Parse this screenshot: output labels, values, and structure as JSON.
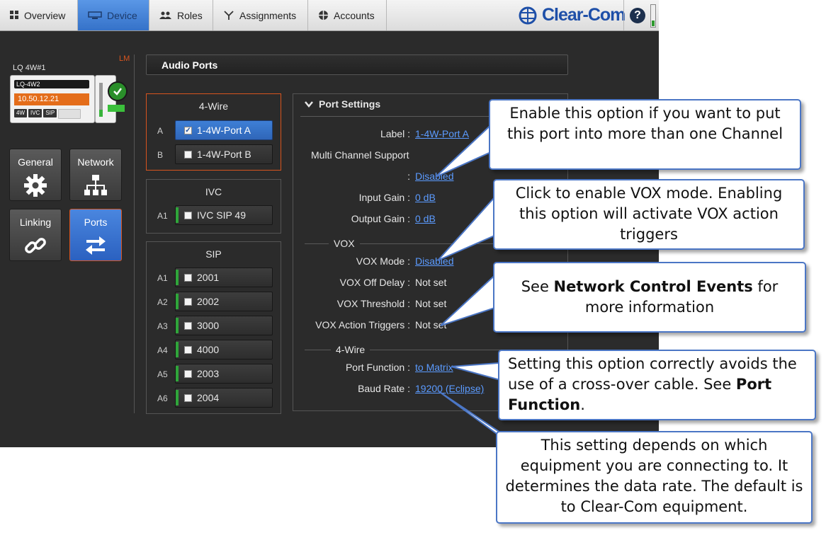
{
  "nav": {
    "tabs": [
      {
        "label": "Overview",
        "icon": "grid-icon"
      },
      {
        "label": "Device",
        "icon": "monitor-icon"
      },
      {
        "label": "Roles",
        "icon": "people-icon"
      },
      {
        "label": "Assignments",
        "icon": "branch-icon"
      },
      {
        "label": "Accounts",
        "icon": "globe-icon"
      }
    ],
    "active_tab": "Device",
    "brand": "Clear-Com",
    "help": "?"
  },
  "device": {
    "badge": "LM",
    "name": "LQ 4W#1",
    "card_name": "LQ-4W2",
    "ip": "10.50.12.21",
    "chips": [
      "4W",
      "IVC",
      "SIP"
    ]
  },
  "side_nav": {
    "general": "General",
    "network": "Network",
    "linking": "Linking",
    "ports": "Ports"
  },
  "audio_ports": {
    "title": "Audio Ports"
  },
  "groups": {
    "fourwire": {
      "title": "4-Wire",
      "ports": [
        {
          "slot": "A",
          "name": "1-4W-Port A",
          "checked": true
        },
        {
          "slot": "B",
          "name": "1-4W-Port B",
          "checked": false
        }
      ]
    },
    "ivc": {
      "title": "IVC",
      "ports": [
        {
          "slot": "A1",
          "name": "IVC SIP 49",
          "checked": false
        }
      ]
    },
    "sip": {
      "title": "SIP",
      "ports": [
        {
          "slot": "A1",
          "name": "2001"
        },
        {
          "slot": "A2",
          "name": "2002"
        },
        {
          "slot": "A3",
          "name": "3000"
        },
        {
          "slot": "A4",
          "name": "4000"
        },
        {
          "slot": "A5",
          "name": "2003"
        },
        {
          "slot": "A6",
          "name": "2004"
        }
      ]
    }
  },
  "port_settings": {
    "title": "Port Settings",
    "label_key": "Label :",
    "label_val": "1-4W-Port A",
    "multi_key": "Multi Channel Support",
    "multi_colon": ":",
    "multi_val": "Disabled",
    "input_gain_key": "Input Gain :",
    "input_gain_val": "0 dB",
    "output_gain_key": "Output Gain :",
    "output_gain_val": "0 dB",
    "vox_section": "VOX",
    "vox_mode_key": "VOX Mode :",
    "vox_mode_val": "Disabled",
    "vox_off_key": "VOX Off Delay :",
    "vox_off_val": "Not set",
    "vox_thr_key": "VOX Threshold :",
    "vox_thr_val": "Not set",
    "vox_act_key": "VOX Action Triggers :",
    "vox_act_val": "Not set",
    "fw_section": "4-Wire",
    "port_func_key": "Port Function :",
    "port_func_val": "to Matrix",
    "baud_key": "Baud Rate :",
    "baud_val": "19200 (Eclipse)"
  },
  "callouts": {
    "c1": "Enable this option if you want to put this port into more than one Channel",
    "c2": "Click to enable VOX mode. Enabling this option will activate VOX action triggers",
    "c3_pre": "See ",
    "c3_bold": "Network Control Events",
    "c3_post": " for more information",
    "c4_pre": "Setting this option correctly avoids the use of a cross-over cable. See ",
    "c4_bold": "Port Function",
    "c4_post": ".",
    "c5": "This setting depends on which equipment you are connecting to. It determines the data rate. The default is to Clear-Com equipment."
  }
}
